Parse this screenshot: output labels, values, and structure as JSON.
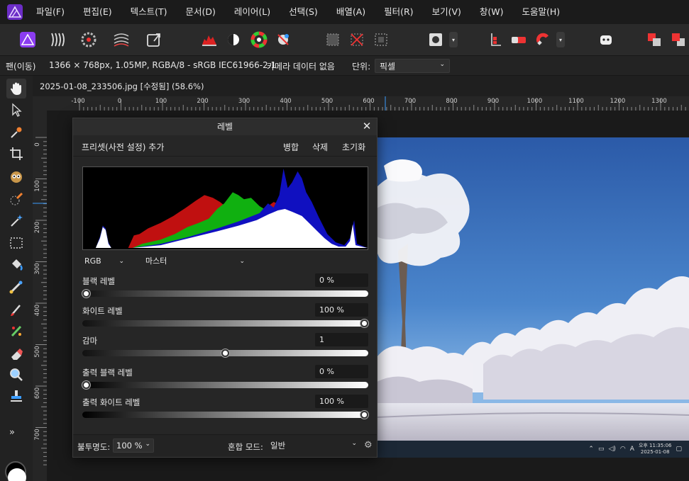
{
  "menu": {
    "items": [
      "파일(F)",
      "편집(E)",
      "텍스트(T)",
      "문서(D)",
      "레이어(L)",
      "선택(S)",
      "배열(A)",
      "필터(R)",
      "보기(V)",
      "창(W)",
      "도움말(H)"
    ]
  },
  "toolbar": {
    "buttons": [
      "photo-persona-icon",
      "liquify-persona-icon",
      "develop-persona-icon",
      "tone-mapping-persona-icon",
      "export-persona-icon",
      "auto-levels-icon",
      "auto-contrast-icon",
      "auto-colors-icon",
      "auto-white-balance-icon",
      "quick-mask-icon",
      "deselect-icon",
      "refine-selection-icon",
      "mask-mode-icon",
      "snapping-icon",
      "magnet-icon",
      "assistant-icon",
      "arrange-back-icon",
      "arrange-front-icon"
    ]
  },
  "context": {
    "tool": "팬(이동)",
    "info": "1366 × 768px, 1.05MP, RGBA/8 - sRGB IEC61966-2.1",
    "camera": "카메라 데이터 없음",
    "unit_label": "단위:",
    "unit_value": "픽셀"
  },
  "document": {
    "tab": "2025-01-08_233506.jpg [수정됨] (58.6%)"
  },
  "ruler": {
    "unit": "px",
    "h_ticks": [
      "-100",
      "0",
      "100",
      "200",
      "300",
      "400",
      "500",
      "600",
      "700",
      "800",
      "900",
      "1000",
      "1100",
      "1200",
      "1300"
    ],
    "v_ticks": [
      "0",
      "100",
      "200",
      "300",
      "400",
      "500",
      "600",
      "700"
    ]
  },
  "levels": {
    "title": "레벨",
    "close": "✕",
    "preset_add": "프리셋(사전 설정) 추가",
    "merge": "병합",
    "delete": "삭제",
    "reset": "초기화",
    "channel": "RGB",
    "mode": "마스터",
    "black_level": {
      "label": "블랙 레벨",
      "value": "0 %",
      "level": 0.0
    },
    "white_level": {
      "label": "화이트 레벨",
      "value": "100 %",
      "level": 1.0
    },
    "gamma": {
      "label": "감마",
      "value": "1",
      "level": 0.5
    },
    "output_black": {
      "label": "출력 블랙 레벨",
      "value": "0 %",
      "level": 0.0
    },
    "output_white": {
      "label": "출력 화이트 레벨",
      "value": "100 %",
      "level": 1.0
    },
    "opacity_label": "불투명도:",
    "opacity_value": "100 %",
    "blend_label": "혼합 모드:",
    "blend_value": "일반"
  },
  "taskbar": {
    "time": "오후 11:35:06",
    "date": "2025-01-08"
  },
  "colors": {
    "accent": "#9b59ff",
    "panel_bg": "#262626",
    "hist_red": "#c01010",
    "hist_green": "#10b010",
    "hist_blue": "#1010c0"
  }
}
